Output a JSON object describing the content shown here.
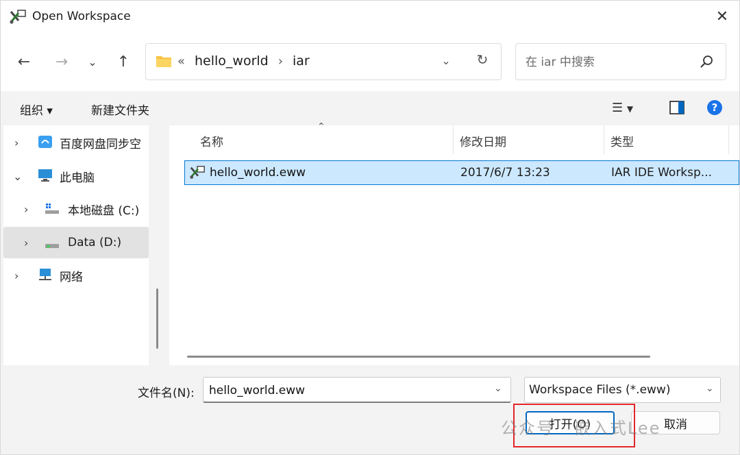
{
  "window": {
    "title": "Open Workspace"
  },
  "navigation": {
    "breadcrumbs": [
      "hello_world",
      "iar"
    ],
    "breadcrumb_prefix": "«",
    "search_placeholder": "在 iar 中搜索"
  },
  "commands": {
    "organize": "组织 ▾",
    "new_folder": "新建文件夹"
  },
  "tree": [
    {
      "label": "百度网盘同步空",
      "icon": "baidu-cloud-icon",
      "expanded": false
    },
    {
      "label": "此电脑",
      "icon": "computer-icon",
      "expanded": true
    },
    {
      "label": "本地磁盘 (C:)",
      "icon": "drive-icon",
      "expanded": false
    },
    {
      "label": "Data (D:)",
      "icon": "drive-icon",
      "expanded": false,
      "selected": true
    },
    {
      "label": "网络",
      "icon": "network-icon",
      "expanded": false
    }
  ],
  "columns": [
    "名称",
    "修改日期",
    "类型"
  ],
  "files": [
    {
      "name": "hello_world.eww",
      "modified": "2017/6/7 13:23",
      "type": "IAR IDE Worksp...",
      "selected": true
    }
  ],
  "bottom": {
    "filename_label": "文件名(N):",
    "filename_value": "hello_world.eww",
    "filetype_value": "Workspace Files (*.eww)",
    "open_label": "打开(O)",
    "cancel_label": "取消"
  },
  "watermark": "公众号 · 嵌入式Lee",
  "colors": {
    "accent": "#0078d4",
    "selection": "#cce8ff",
    "highlight_box": "#e3262a"
  }
}
